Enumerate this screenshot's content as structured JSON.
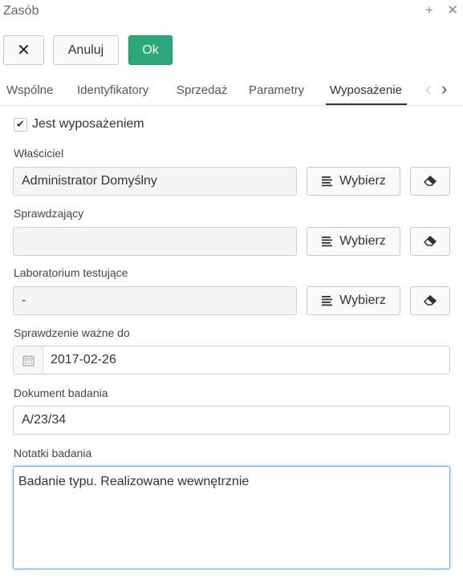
{
  "window": {
    "title": "Zasób"
  },
  "toolbar": {
    "close_label": "✕",
    "cancel_label": "Anuluj",
    "ok_label": "Ok"
  },
  "tabs": [
    {
      "label": "Wspólne"
    },
    {
      "label": "Identyfikatory"
    },
    {
      "label": "Sprzedaż"
    },
    {
      "label": "Parametry"
    },
    {
      "label": "Wyposażenie",
      "active": true
    }
  ],
  "form": {
    "is_equipment": {
      "label": "Jest wyposażeniem",
      "checked": true
    },
    "owner": {
      "label": "Właściciel",
      "value": "Administrator Domyślny"
    },
    "checker": {
      "label": "Sprawdzający",
      "value": ""
    },
    "lab": {
      "label": "Laboratorium testujące",
      "value": "-"
    },
    "pick_label": "Wybierz",
    "valid_until": {
      "label": "Sprawdzenie ważne do",
      "value": "2017-02-26"
    },
    "test_doc": {
      "label": "Dokument badania",
      "value": "A/23/34"
    },
    "test_notes": {
      "label": "Notatki badania",
      "value": "Badanie typu. Realizowane wewnętrznie"
    }
  },
  "icons": {
    "plus": "plus-icon",
    "close": "close-icon",
    "list": "list-icon",
    "eraser": "eraser-icon",
    "calendar": "calendar-icon",
    "chevron_left": "chevron-left-icon",
    "chevron_right": "chevron-right-icon",
    "check": "check-icon"
  },
  "colors": {
    "ok_button": "#2aa87a",
    "focus_border": "#66afe9"
  }
}
